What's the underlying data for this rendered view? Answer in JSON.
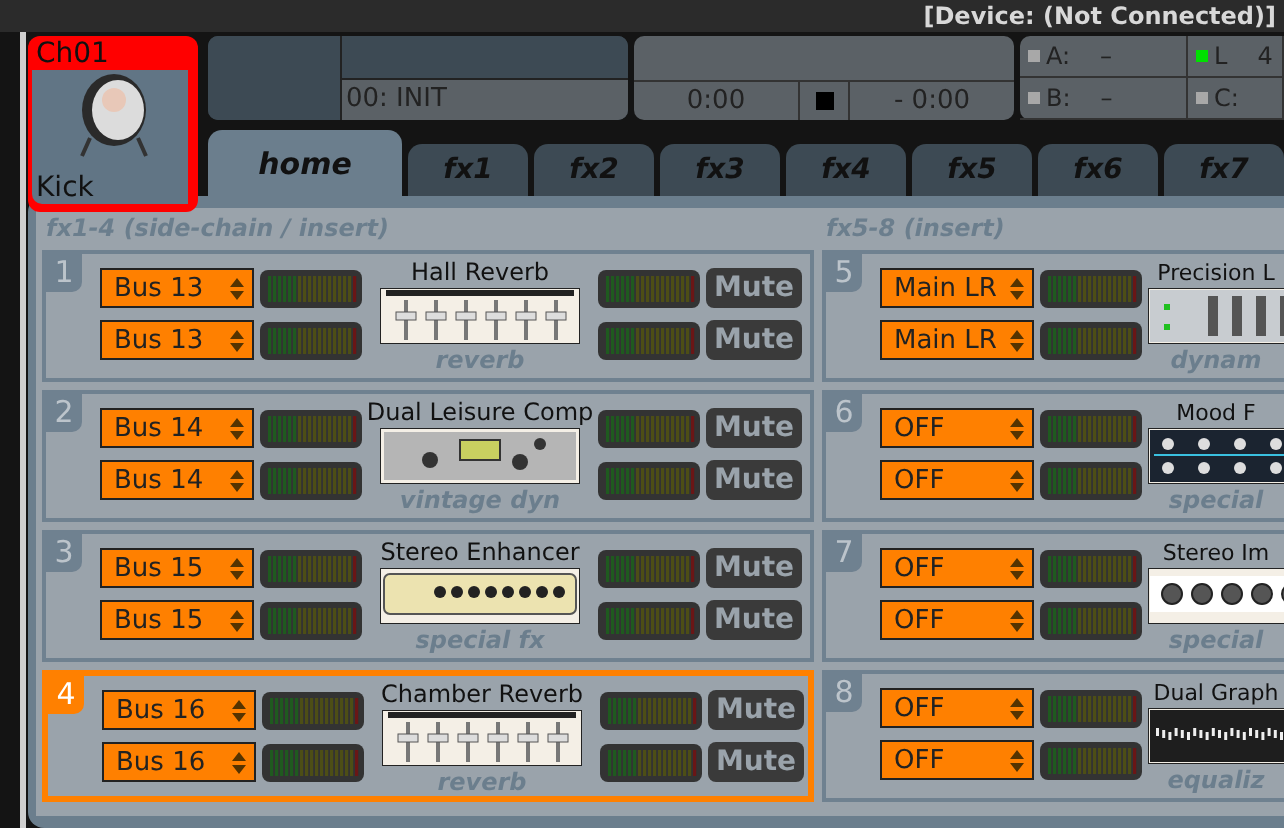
{
  "title_bar": {
    "title": "[Device: (Not Connected)]"
  },
  "channel": {
    "id": "Ch01",
    "name": "Kick"
  },
  "preset": {
    "name": "00: INIT"
  },
  "transport": {
    "elapsed": "0:00",
    "remaining": "- 0:00"
  },
  "status": [
    {
      "label": "A:",
      "value": "–",
      "color": "#a8a8a8"
    },
    {
      "label": "L",
      "value": "4",
      "color": "#00e000"
    },
    {
      "label": "B:",
      "value": "–",
      "color": "#a8a8a8"
    },
    {
      "label": "C:",
      "color": "#a8a8a8"
    }
  ],
  "tabs": [
    {
      "label": "home",
      "selected": true
    },
    {
      "label": "fx1",
      "selected": false
    },
    {
      "label": "fx2",
      "selected": false
    },
    {
      "label": "fx3",
      "selected": false
    },
    {
      "label": "fx4",
      "selected": false
    },
    {
      "label": "fx5",
      "selected": false
    },
    {
      "label": "fx6",
      "selected": false
    },
    {
      "label": "fx7",
      "selected": false
    }
  ],
  "sections": [
    {
      "title": "fx1-4 (side-chain / insert)",
      "slots": [
        {
          "number": "1",
          "selected": false,
          "inputs": [
            "Bus 13",
            "Bus 13"
          ],
          "name": "Hall Reverb",
          "kind": "faders",
          "category": "reverb",
          "mutes": [
            "Mute",
            "Mute"
          ]
        },
        {
          "number": "2",
          "selected": false,
          "inputs": [
            "Bus 14",
            "Bus 14"
          ],
          "name": "Dual Leisure Comp",
          "kind": "comp",
          "category": "vintage dyn",
          "mutes": [
            "Mute",
            "Mute"
          ]
        },
        {
          "number": "3",
          "selected": false,
          "inputs": [
            "Bus 15",
            "Bus 15"
          ],
          "name": "Stereo Enhancer",
          "kind": "knobs",
          "category": "special fx",
          "mutes": [
            "Mute",
            "Mute"
          ]
        },
        {
          "number": "4",
          "selected": true,
          "inputs": [
            "Bus 16",
            "Bus 16"
          ],
          "name": "Chamber Reverb",
          "kind": "faders",
          "category": "reverb",
          "mutes": [
            "Mute",
            "Mute"
          ]
        }
      ]
    },
    {
      "title": "fx5-8 (insert)",
      "slots": [
        {
          "number": "5",
          "selected": false,
          "inputs": [
            "Main LR",
            "Main LR"
          ],
          "name": "Precision L",
          "kind": "meters",
          "category": "dynam"
        },
        {
          "number": "6",
          "selected": false,
          "inputs": [
            "OFF",
            "OFF"
          ],
          "name": "Mood F",
          "kind": "blueknobs",
          "category": "special"
        },
        {
          "number": "7",
          "selected": false,
          "inputs": [
            "OFF",
            "OFF"
          ],
          "name": "Stereo Im",
          "kind": "knobrow",
          "category": "special"
        },
        {
          "number": "8",
          "selected": false,
          "inputs": [
            "OFF",
            "OFF"
          ],
          "name": "Dual Graph",
          "kind": "eq",
          "category": "equaliz"
        }
      ]
    }
  ]
}
